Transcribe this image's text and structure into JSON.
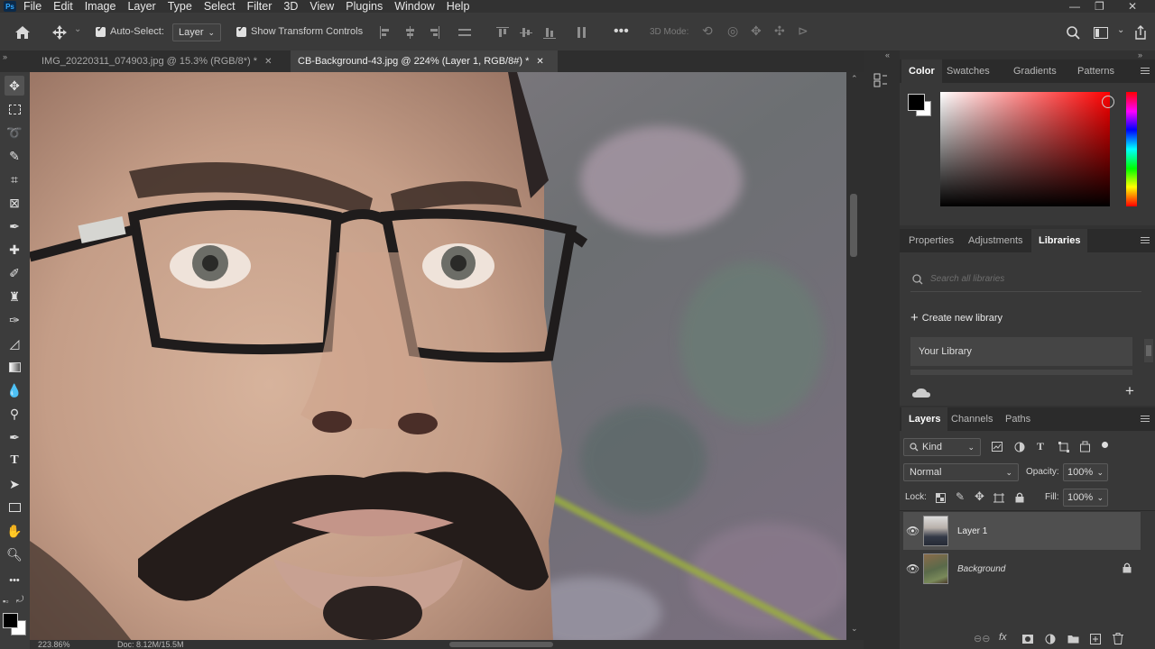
{
  "app": {
    "logo": "Ps"
  },
  "menu": [
    "File",
    "Edit",
    "Image",
    "Layer",
    "Type",
    "Select",
    "Filter",
    "3D",
    "View",
    "Plugins",
    "Window",
    "Help"
  ],
  "options": {
    "auto_select_label": "Auto-Select:",
    "auto_select_target": "Layer",
    "show_transform_label": "Show Transform Controls",
    "three_d_mode_label": "3D Mode:"
  },
  "tabs": [
    {
      "label": "IMG_20220311_074903.jpg @ 15.3% (RGB/8*) *",
      "active": false
    },
    {
      "label": "CB-Background-43.jpg @ 224% (Layer 1, RGB/8#) *",
      "active": true
    }
  ],
  "status": {
    "zoom": "223.86%",
    "doc": "Doc: 8.12M/15.5M"
  },
  "color_panel": {
    "tabs": [
      "Color",
      "Swatches",
      "Gradients",
      "Patterns"
    ],
    "active_tab": "Color",
    "hue_color": "#ff0000"
  },
  "libraries_panel": {
    "tabs": [
      "Properties",
      "Adjustments",
      "Libraries"
    ],
    "active_tab": "Libraries",
    "search_placeholder": "Search all libraries",
    "create_label": "Create new library",
    "library_name": "Your Library"
  },
  "layers_panel": {
    "tabs": [
      "Layers",
      "Channels",
      "Paths"
    ],
    "active_tab": "Layers",
    "filter_kind": "Kind",
    "blend_mode": "Normal",
    "opacity_label": "Opacity:",
    "opacity_value": "100%",
    "lock_label": "Lock:",
    "fill_label": "Fill:",
    "fill_value": "100%",
    "layers": [
      {
        "name": "Layer 1",
        "selected": true,
        "locked": false
      },
      {
        "name": "Background",
        "selected": false,
        "locked": true
      }
    ]
  }
}
